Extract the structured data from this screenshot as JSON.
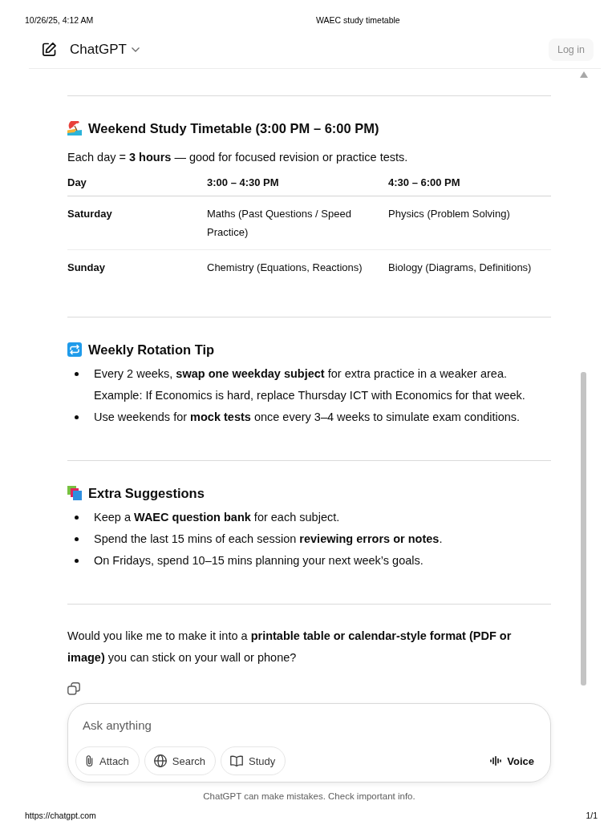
{
  "print_header": {
    "timestamp": "10/26/25, 4:12 AM",
    "title": "WAEC study timetable"
  },
  "app_header": {
    "title": "ChatGPT",
    "login_button": "Log in"
  },
  "sections": [
    {
      "kind": "table",
      "heading": "Weekend Study Timetable (3:00 PM – 6:00 PM)",
      "intro": "Each day = **3 hours** — good for focused revision or practice tests.",
      "table": {
        "columns": [
          "Day",
          "3:00 – 4:30 PM",
          "4:30 – 6:00 PM"
        ],
        "rows": [
          [
            "Saturday",
            "Maths (Past Questions / Speed Practice)",
            "Physics (Problem Solving)"
          ],
          [
            "Sunday",
            "Chemistry (Equations, Reactions)",
            "Biology (Diagrams, Definitions)"
          ]
        ]
      }
    },
    {
      "kind": "list",
      "heading": "Weekly Rotation Tip",
      "items": [
        {
          "text": "Every 2 weeks, **swap one weekday subject** for extra practice in a weaker area.",
          "note": "Example: If Economics is hard, replace Thursday ICT with Economics for that week."
        },
        {
          "text": "Use weekends for **mock tests** once every 3–4 weeks to simulate exam conditions."
        }
      ]
    },
    {
      "kind": "list",
      "heading": "Extra Suggestions",
      "items": [
        {
          "text": "Keep a **WAEC question bank** for each subject."
        },
        {
          "text": "Spend the last 15 mins of each session **reviewing errors or notes**."
        },
        {
          "text": "On Fridays, spend 10–15 mins planning your next week’s goals."
        }
      ]
    }
  ],
  "closing": "Would you like me to make it into a **printable table or calendar-style format (PDF or image)** you can stick on your wall or phone?",
  "composer": {
    "placeholder": "Ask anything",
    "tools": [
      {
        "label": "Attach"
      },
      {
        "label": "Search"
      },
      {
        "label": "Study"
      }
    ],
    "voice_button": "Voice"
  },
  "disclaimer": "ChatGPT can make mistakes. Check important info.",
  "print_footer": {
    "url": "https://chatgpt.com",
    "page": "1/1"
  }
}
